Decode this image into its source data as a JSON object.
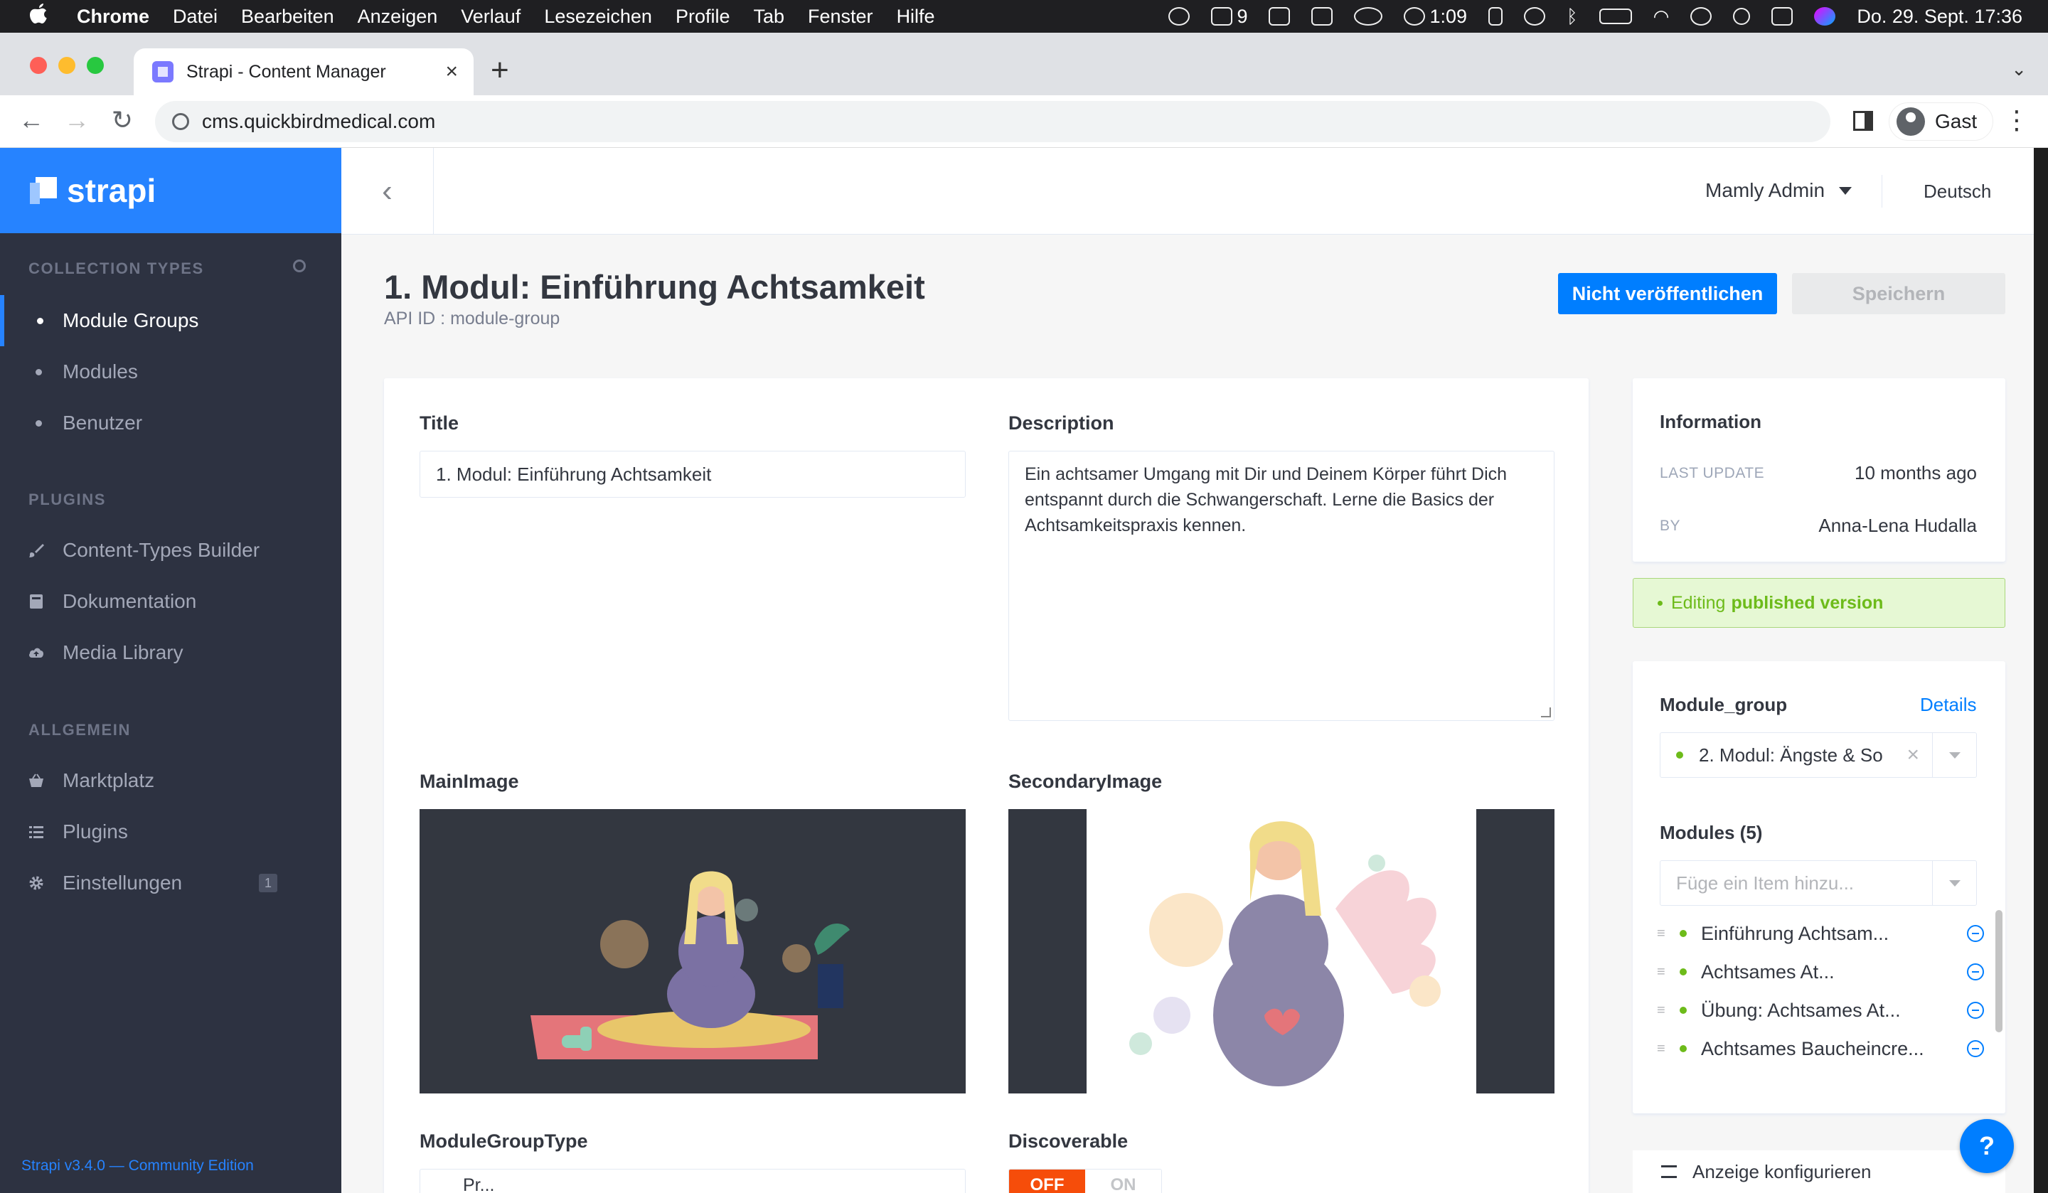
{
  "menubar": {
    "app": "Chrome",
    "items": [
      "Datei",
      "Bearbeiten",
      "Anzeigen",
      "Verlauf",
      "Lesezeichen",
      "Profile",
      "Tab",
      "Fenster",
      "Hilfe"
    ],
    "status_count": "9",
    "timer": "1:09",
    "datetime": "Do. 29. Sept.  17:36"
  },
  "browser": {
    "tab_title": "Strapi - Content Manager",
    "url": "cms.quickbirdmedical.com",
    "profile_name": "Gast"
  },
  "sidebar": {
    "brand": "strapi",
    "collection_title": "COLLECTION TYPES",
    "collection_items": [
      {
        "label": "Module Groups",
        "active": true
      },
      {
        "label": "Modules",
        "active": false
      },
      {
        "label": "Benutzer",
        "active": false
      }
    ],
    "plugins_title": "PLUGINS",
    "plugin_items": [
      {
        "label": "Content-Types Builder",
        "icon": "paintbrush-icon"
      },
      {
        "label": "Dokumentation",
        "icon": "book-icon"
      },
      {
        "label": "Media Library",
        "icon": "cloud-upload-icon"
      }
    ],
    "general_title": "ALLGEMEIN",
    "general_items": [
      {
        "label": "Marktplatz",
        "icon": "basket-icon"
      },
      {
        "label": "Plugins",
        "icon": "list-icon"
      },
      {
        "label": "Einstellungen",
        "icon": "gear-icon",
        "badge": "1"
      }
    ],
    "version": "Strapi v3.4.0 — Community Edition"
  },
  "header": {
    "user": "Mamly Admin",
    "language": "Deutsch"
  },
  "page": {
    "title": "1. Modul: Einführung Achtsamkeit",
    "api_id": "API ID : module-group",
    "unpublish_button": "Nicht veröffentlichen",
    "save_button": "Speichern"
  },
  "form": {
    "title_label": "Title",
    "title_value": "1. Modul: Einführung Achtsamkeit",
    "description_label": "Description",
    "description_value": "Ein achtsamer Umgang mit Dir und Deinem Körper führt Dich entspannt durch die Schwangerschaft. Lerne die Basics der Achtsamkeitspraxis kennen.",
    "main_image_label": "MainImage",
    "secondary_image_label": "SecondaryImage",
    "module_group_type_label": "ModuleGroupType",
    "module_group_type_value": "Pr...",
    "discoverable_label": "Discoverable",
    "discoverable_off": "OFF",
    "discoverable_on": "ON"
  },
  "info": {
    "title": "Information",
    "last_update_key": "LAST UPDATE",
    "last_update_value": "10 months ago",
    "by_key": "BY",
    "by_value": "Anna-Lena Hudalla",
    "editing_prefix": "Editing",
    "editing_status": "published version"
  },
  "relations": {
    "module_group_label": "Module_group",
    "details_link": "Details",
    "module_group_value": "2. Modul: Ängste & So",
    "modules_label": "Modules (5)",
    "add_placeholder": "Füge ein Item hinzu...",
    "modules": [
      "Einführung Achtsam...",
      "Achtsames At...",
      "Übung: Achtsames At...",
      "Achtsames Baucheincre..."
    ],
    "configure_view": "Anzeige konfigurieren"
  },
  "colors": {
    "strapi_blue": "#2683ff",
    "sidebar_bg": "#2d3241",
    "primary_button": "#007eff",
    "published_green": "#6dbb1a",
    "toggle_off": "#f64d0a"
  }
}
